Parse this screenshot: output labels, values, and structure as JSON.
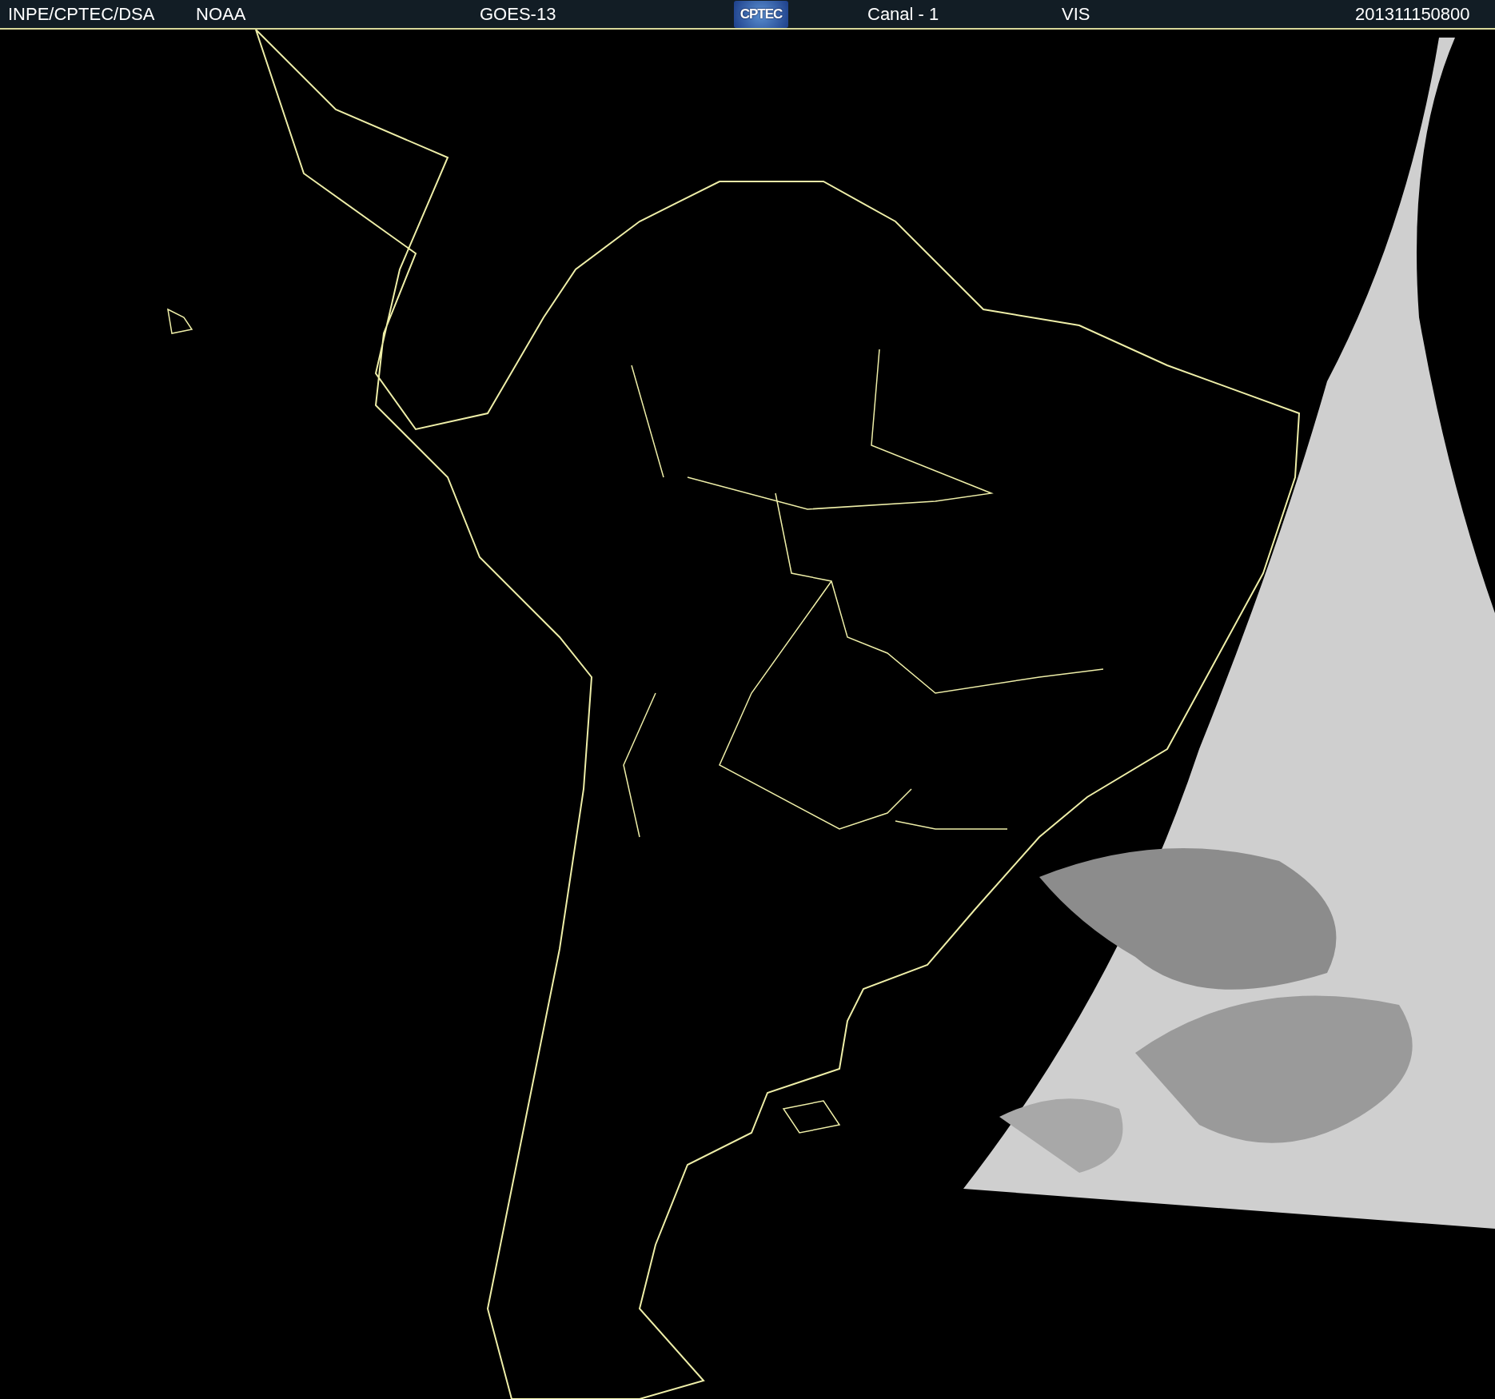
{
  "header": {
    "source": "INPE/CPTEC/DSA",
    "agency": "NOAA",
    "satellite": "GOES-13",
    "logo_text": "CPTEC",
    "channel": "Canal - 1",
    "band": "VIS",
    "timestamp": "201311150800"
  }
}
